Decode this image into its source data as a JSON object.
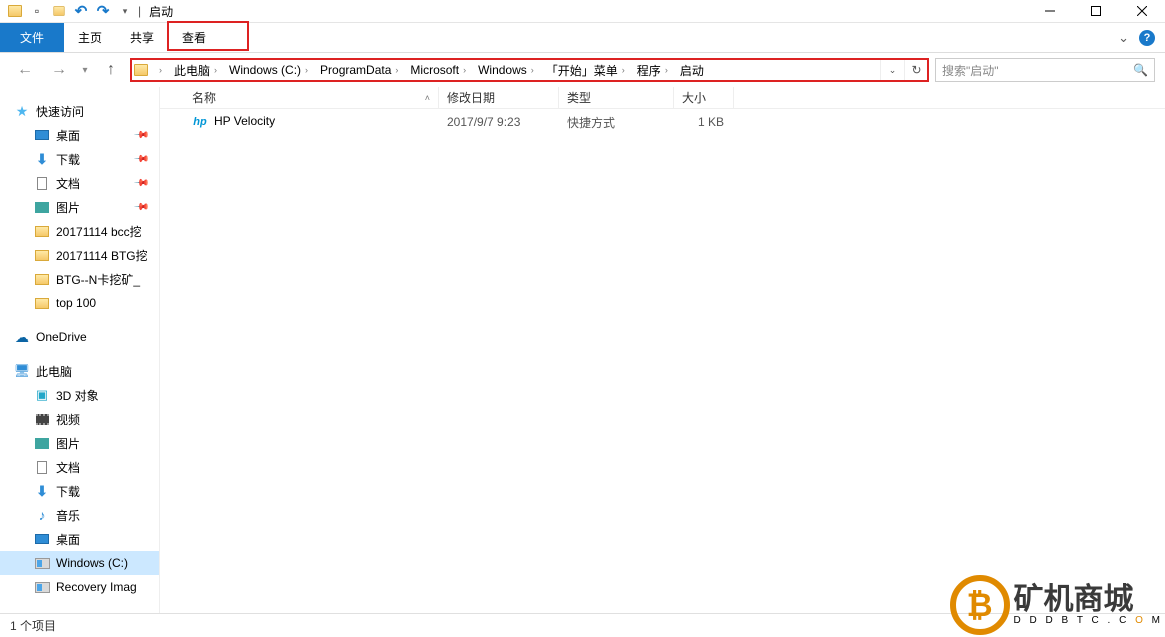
{
  "window": {
    "title": "启动"
  },
  "tabs": {
    "file": "文件",
    "home": "主页",
    "share": "共享",
    "view": "查看"
  },
  "breadcrumb": [
    "此电脑",
    "Windows (C:)",
    "ProgramData",
    "Microsoft",
    "Windows",
    "「开始」菜单",
    "程序",
    "启动"
  ],
  "search": {
    "placeholder": "搜索\"启动\""
  },
  "columns": {
    "name": "名称",
    "modified": "修改日期",
    "type": "类型",
    "size": "大小"
  },
  "rows": [
    {
      "icon": "hp",
      "name": "HP Velocity",
      "modified": "2017/9/7 9:23",
      "type": "快捷方式",
      "size": "1 KB"
    }
  ],
  "sidebar": {
    "quick": {
      "label": "快速访问",
      "items": [
        {
          "icon": "desktop",
          "label": "桌面",
          "pinned": true
        },
        {
          "icon": "dl",
          "label": "下载",
          "pinned": true
        },
        {
          "icon": "doc",
          "label": "文档",
          "pinned": true
        },
        {
          "icon": "pic",
          "label": "图片",
          "pinned": true
        },
        {
          "icon": "fld",
          "label": "20171114 bcc挖"
        },
        {
          "icon": "fld",
          "label": "20171114 BTG挖"
        },
        {
          "icon": "fld",
          "label": "BTG--N卡挖矿_"
        },
        {
          "icon": "fld",
          "label": "top 100"
        }
      ]
    },
    "onedrive": {
      "label": "OneDrive"
    },
    "thispc": {
      "label": "此电脑",
      "items": [
        {
          "icon": "cube",
          "label": "3D 对象"
        },
        {
          "icon": "reel",
          "label": "视频"
        },
        {
          "icon": "pic",
          "label": "图片"
        },
        {
          "icon": "doc",
          "label": "文档"
        },
        {
          "icon": "dl",
          "label": "下载"
        },
        {
          "icon": "note",
          "label": "音乐"
        },
        {
          "icon": "desktop",
          "label": "桌面"
        },
        {
          "icon": "hdd",
          "label": "Windows (C:)",
          "selected": true
        },
        {
          "icon": "hdd",
          "label": "Recovery Imag"
        }
      ]
    }
  },
  "status": {
    "count": "1 个项目"
  },
  "watermark": {
    "text": "矿机商城",
    "sub_pre": "D D D B T C . C",
    "sub_hl": " O ",
    "sub_post": "M"
  }
}
